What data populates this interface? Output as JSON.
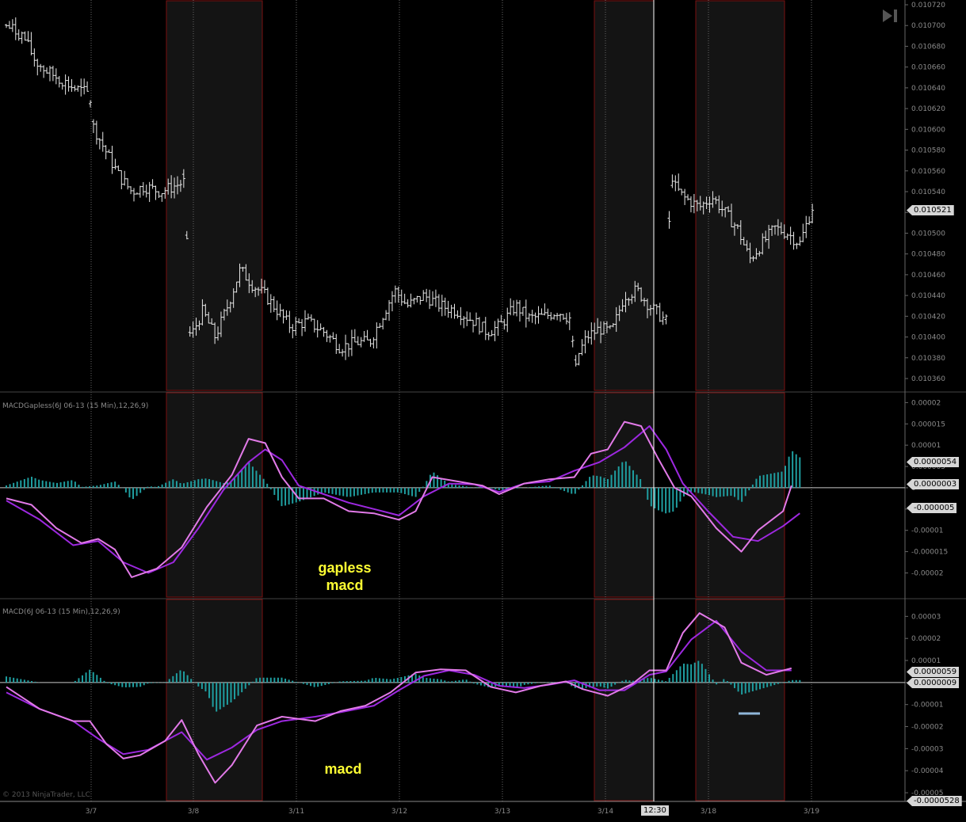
{
  "toolbar": {
    "play_end_icon": "skip-to-end-icon"
  },
  "colors": {
    "background": "#000000",
    "price_bars": "#e8e8e8",
    "session_shade": "#141414",
    "session_border": "#7a1010",
    "macd_line": "#e27ae8",
    "signal_line": "#9d28e0",
    "histogram": "#1f9ea0",
    "zero_line": "#c8c8c8",
    "annotation": "#ffff33",
    "cursor_line": "#ffffff"
  },
  "panels": {
    "price": {
      "axis_ticks": [
        "0.010720",
        "0.010700",
        "0.010680",
        "0.010660",
        "0.010640",
        "0.010620",
        "0.010600",
        "0.010580",
        "0.010560",
        "0.010540",
        "0.010520",
        "0.010500",
        "0.010480",
        "0.010460",
        "0.010440",
        "0.010420",
        "0.010400",
        "0.010380",
        "0.010360"
      ],
      "last_price_tag": "0.010521"
    },
    "gapless": {
      "title": "MACDGapless(6J 06-13 (15 Min),12,26,9)",
      "axis_ticks": [
        "0.00002",
        "0.000015",
        "0.00001",
        "0.000005",
        "0",
        "-0.000005",
        "-0.00001",
        "-0.000015",
        "-0.00002"
      ],
      "tags": [
        "0.0000054",
        "0.0000003",
        "-0.000005"
      ],
      "annotation": [
        "gapless",
        "macd"
      ]
    },
    "macd": {
      "title": "MACD(6J 06-13 (15 Min),12,26,9)",
      "axis_ticks": [
        "0.00003",
        "0.00002",
        "0.00001",
        "0",
        "-0.00001",
        "-0.00002",
        "-0.00003",
        "-0.00004",
        "-0.00005"
      ],
      "tags": [
        "0.0000059",
        "0.0000009",
        "-0.0000528"
      ],
      "annotation": "macd"
    }
  },
  "x_axis": {
    "dates": [
      "3/7",
      "3/8",
      "3/11",
      "3/12",
      "3/13",
      "3/14",
      "3/18",
      "3/19"
    ],
    "cursor_time": "12:30"
  },
  "copyright": "© 2013 NinjaTrader, LLC",
  "chart_data": [
    {
      "type": "ohlc",
      "title": "",
      "instrument": "6J 06-13 (15 Min)",
      "ylim": [
        0.010355,
        0.010725
      ],
      "last": 0.010521,
      "sessions": [
        "3/7",
        "3/8",
        "3/11",
        "3/12",
        "3/13",
        "3/14",
        "3/18",
        "3/19"
      ],
      "close_path": [
        [
          0.0,
          0.0107
        ],
        [
          0.02,
          0.01069
        ],
        [
          0.035,
          0.010665
        ],
        [
          0.05,
          0.010655
        ],
        [
          0.065,
          0.010648
        ],
        [
          0.08,
          0.01064
        ],
        [
          0.1,
          0.010634
        ],
        [
          0.103,
          0.010605
        ],
        [
          0.115,
          0.010585
        ],
        [
          0.135,
          0.010555
        ],
        [
          0.15,
          0.01054
        ],
        [
          0.165,
          0.010545
        ],
        [
          0.185,
          0.01054
        ],
        [
          0.2,
          0.010545
        ],
        [
          0.215,
          0.01055
        ],
        [
          0.218,
          0.010395
        ],
        [
          0.235,
          0.010425
        ],
        [
          0.25,
          0.0104
        ],
        [
          0.265,
          0.01043
        ],
        [
          0.28,
          0.010465
        ],
        [
          0.295,
          0.01045
        ],
        [
          0.31,
          0.01044
        ],
        [
          0.325,
          0.010425
        ],
        [
          0.34,
          0.01041
        ],
        [
          0.36,
          0.010415
        ],
        [
          0.38,
          0.010405
        ],
        [
          0.4,
          0.01039
        ],
        [
          0.42,
          0.010395
        ],
        [
          0.435,
          0.010395
        ],
        [
          0.45,
          0.01042
        ],
        [
          0.465,
          0.010445
        ],
        [
          0.48,
          0.01043
        ],
        [
          0.5,
          0.01044
        ],
        [
          0.52,
          0.01043
        ],
        [
          0.54,
          0.010425
        ],
        [
          0.56,
          0.010415
        ],
        [
          0.575,
          0.010405
        ],
        [
          0.59,
          0.01041
        ],
        [
          0.61,
          0.01043
        ],
        [
          0.625,
          0.010418
        ],
        [
          0.645,
          0.01042
        ],
        [
          0.66,
          0.010425
        ],
        [
          0.675,
          0.010418
        ],
        [
          0.68,
          0.010375
        ],
        [
          0.695,
          0.0104
        ],
        [
          0.71,
          0.010408
        ],
        [
          0.725,
          0.010405
        ],
        [
          0.74,
          0.01044
        ],
        [
          0.755,
          0.010445
        ],
        [
          0.77,
          0.01043
        ],
        [
          0.79,
          0.010415
        ],
        [
          0.795,
          0.01055
        ],
        [
          0.81,
          0.010535
        ],
        [
          0.83,
          0.010525
        ],
        [
          0.845,
          0.010535
        ],
        [
          0.86,
          0.01052
        ],
        [
          0.875,
          0.010505
        ],
        [
          0.89,
          0.010475
        ],
        [
          0.905,
          0.01049
        ],
        [
          0.92,
          0.010505
        ],
        [
          0.935,
          0.0105
        ],
        [
          0.95,
          0.01049
        ],
        [
          0.965,
          0.010525
        ]
      ]
    },
    {
      "type": "macd",
      "title": "MACDGapless(6J 06-13 (15 Min),12,26,9)",
      "ylim": [
        -2.4e-05,
        2.1e-05
      ],
      "macd": [
        [
          0.0,
          -2.5e-06
        ],
        [
          0.03,
          -4e-06
        ],
        [
          0.06,
          -9.5e-06
        ],
        [
          0.09,
          -1.3e-05
        ],
        [
          0.11,
          -1.2e-05
        ],
        [
          0.13,
          -1.45e-05
        ],
        [
          0.15,
          -2.1e-05
        ],
        [
          0.18,
          -1.9e-05
        ],
        [
          0.21,
          -1.4e-05
        ],
        [
          0.24,
          -4.5e-06
        ],
        [
          0.27,
          3e-06
        ],
        [
          0.29,
          1.15e-05
        ],
        [
          0.31,
          1.05e-05
        ],
        [
          0.33,
          2.5e-06
        ],
        [
          0.35,
          -2.5e-06
        ],
        [
          0.38,
          -2.5e-06
        ],
        [
          0.41,
          -5.5e-06
        ],
        [
          0.44,
          -6e-06
        ],
        [
          0.47,
          -7.5e-06
        ],
        [
          0.49,
          -5.5e-06
        ],
        [
          0.51,
          2.5e-06
        ],
        [
          0.54,
          1.5e-06
        ],
        [
          0.57,
          5e-07
        ],
        [
          0.59,
          -1.5e-06
        ],
        [
          0.62,
          1e-06
        ],
        [
          0.65,
          2e-06
        ],
        [
          0.68,
          2.5e-06
        ],
        [
          0.7,
          8e-06
        ],
        [
          0.72,
          9e-06
        ],
        [
          0.74,
          1.55e-05
        ],
        [
          0.76,
          1.45e-05
        ],
        [
          0.78,
          7e-06
        ],
        [
          0.8,
          0.0
        ],
        [
          0.82,
          -2e-06
        ],
        [
          0.85,
          -9.5e-06
        ],
        [
          0.88,
          -1.5e-05
        ],
        [
          0.9,
          -1e-05
        ],
        [
          0.93,
          -5.5e-06
        ],
        [
          0.94,
          5e-07
        ]
      ],
      "signal": [
        [
          0.0,
          -3e-06
        ],
        [
          0.04,
          -7.5e-06
        ],
        [
          0.08,
          -1.35e-05
        ],
        [
          0.11,
          -1.25e-05
        ],
        [
          0.14,
          -1.75e-05
        ],
        [
          0.17,
          -2e-05
        ],
        [
          0.2,
          -1.75e-05
        ],
        [
          0.23,
          -9.5e-06
        ],
        [
          0.26,
          -5e-07
        ],
        [
          0.29,
          6e-06
        ],
        [
          0.31,
          9e-06
        ],
        [
          0.33,
          6.5e-06
        ],
        [
          0.35,
          5e-07
        ],
        [
          0.38,
          -1.5e-06
        ],
        [
          0.41,
          -3.5e-06
        ],
        [
          0.44,
          -5e-06
        ],
        [
          0.47,
          -6.5e-06
        ],
        [
          0.5,
          -2e-06
        ],
        [
          0.53,
          1e-06
        ],
        [
          0.56,
          8e-07
        ],
        [
          0.59,
          -1e-06
        ],
        [
          0.62,
          1e-06
        ],
        [
          0.65,
          1.5e-06
        ],
        [
          0.68,
          4e-06
        ],
        [
          0.71,
          6e-06
        ],
        [
          0.74,
          9.5e-06
        ],
        [
          0.77,
          1.45e-05
        ],
        [
          0.79,
          9e-06
        ],
        [
          0.81,
          1e-06
        ],
        [
          0.84,
          -5.5e-06
        ],
        [
          0.87,
          -1.15e-05
        ],
        [
          0.9,
          -1.25e-05
        ],
        [
          0.93,
          -9e-06
        ],
        [
          0.95,
          -6e-06
        ]
      ]
    },
    {
      "type": "macd",
      "title": "MACD(6J 06-13 (15 Min),12,26,9)",
      "ylim": [
        -5.25e-05,
        3.3e-05
      ],
      "macd": [
        [
          0.0,
          -2e-06
        ],
        [
          0.04,
          -1.2e-05
        ],
        [
          0.08,
          -1.75e-05
        ],
        [
          0.1,
          -1.75e-05
        ],
        [
          0.12,
          -2.8e-05
        ],
        [
          0.14,
          -3.45e-05
        ],
        [
          0.16,
          -3.3e-05
        ],
        [
          0.19,
          -2.65e-05
        ],
        [
          0.21,
          -1.7e-05
        ],
        [
          0.23,
          -3.25e-05
        ],
        [
          0.25,
          -4.55e-05
        ],
        [
          0.27,
          -3.75e-05
        ],
        [
          0.3,
          -1.95e-05
        ],
        [
          0.33,
          -1.55e-05
        ],
        [
          0.37,
          -1.75e-05
        ],
        [
          0.4,
          -1.3e-05
        ],
        [
          0.43,
          -1.05e-05
        ],
        [
          0.46,
          -4.5e-06
        ],
        [
          0.49,
          4.5e-06
        ],
        [
          0.52,
          6e-06
        ],
        [
          0.55,
          5.5e-06
        ],
        [
          0.58,
          -2e-06
        ],
        [
          0.61,
          -4.5e-06
        ],
        [
          0.64,
          -1.5e-06
        ],
        [
          0.67,
          5e-07
        ],
        [
          0.69,
          -3e-06
        ],
        [
          0.72,
          -6e-06
        ],
        [
          0.75,
          -5e-07
        ],
        [
          0.77,
          5.5e-06
        ],
        [
          0.79,
          5.5e-06
        ],
        [
          0.81,
          2.25e-05
        ],
        [
          0.83,
          3.15e-05
        ],
        [
          0.86,
          2.5e-05
        ],
        [
          0.88,
          9e-06
        ],
        [
          0.91,
          3.5e-06
        ],
        [
          0.94,
          6.5e-06
        ]
      ],
      "signal": [
        [
          0.0,
          -4.5e-06
        ],
        [
          0.04,
          -1.2e-05
        ],
        [
          0.08,
          -1.75e-05
        ],
        [
          0.11,
          -2.55e-05
        ],
        [
          0.14,
          -3.25e-05
        ],
        [
          0.17,
          -3.05e-05
        ],
        [
          0.21,
          -2.25e-05
        ],
        [
          0.24,
          -3.5e-05
        ],
        [
          0.27,
          -2.95e-05
        ],
        [
          0.3,
          -2.15e-05
        ],
        [
          0.33,
          -1.75e-05
        ],
        [
          0.37,
          -1.55e-05
        ],
        [
          0.4,
          -1.35e-05
        ],
        [
          0.44,
          -1.05e-05
        ],
        [
          0.47,
          -3.5e-06
        ],
        [
          0.5,
          3e-06
        ],
        [
          0.53,
          5.5e-06
        ],
        [
          0.56,
          3.5e-06
        ],
        [
          0.59,
          -1.5e-06
        ],
        [
          0.62,
          -2.5e-06
        ],
        [
          0.65,
          -1e-06
        ],
        [
          0.68,
          1e-06
        ],
        [
          0.71,
          -3.5e-06
        ],
        [
          0.74,
          -3.5e-06
        ],
        [
          0.77,
          3.5e-06
        ],
        [
          0.79,
          5e-06
        ],
        [
          0.82,
          1.95e-05
        ],
        [
          0.85,
          2.8e-05
        ],
        [
          0.88,
          1.4e-05
        ],
        [
          0.91,
          5.5e-06
        ],
        [
          0.94,
          5.5e-06
        ]
      ]
    }
  ]
}
